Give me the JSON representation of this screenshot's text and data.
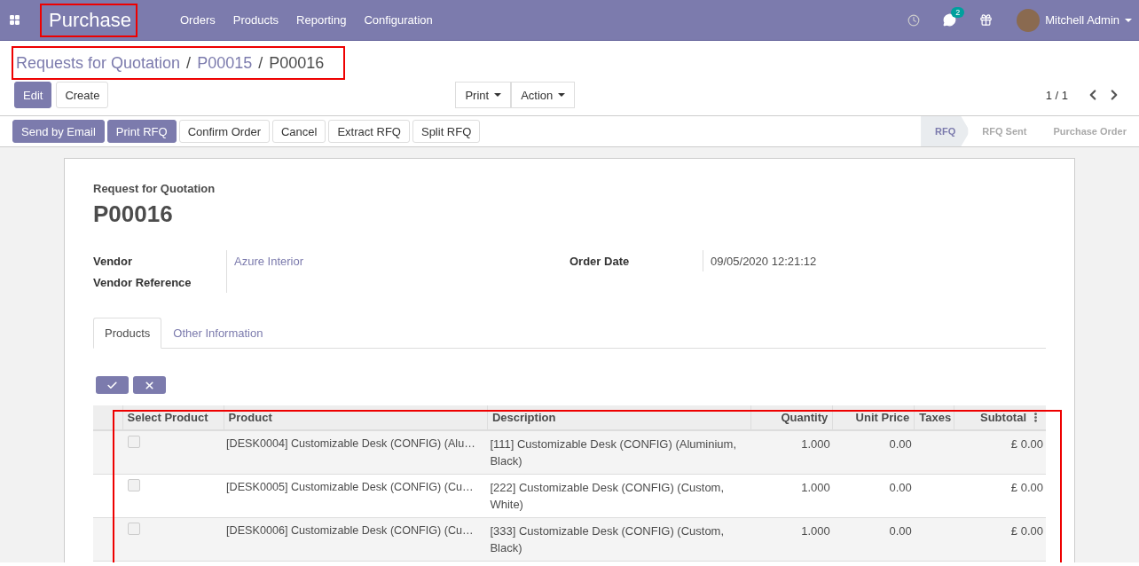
{
  "navbar": {
    "app_title": {
      "text": "Purchase",
      "highlighted": true
    },
    "menu": [
      "Orders",
      "Products",
      "Reporting",
      "Configuration"
    ],
    "messages_badge": "2",
    "user": "Mitchell Admin"
  },
  "breadcrumb": {
    "highlighted": true,
    "separator": "/",
    "items": [
      {
        "label": "Requests for Quotation",
        "current": false
      },
      {
        "label": "P00015",
        "current": false
      },
      {
        "label": "P00016",
        "current": true
      }
    ]
  },
  "control_buttons": [
    {
      "label": "Edit",
      "primary": true
    },
    {
      "label": "Create",
      "primary": false
    }
  ],
  "dropdowns": [
    "Print",
    "Action"
  ],
  "pager": "1 / 1",
  "header_buttons": [
    {
      "label": "Send by Email",
      "primary": true
    },
    {
      "label": "Print RFQ",
      "primary": true
    },
    {
      "label": "Confirm Order",
      "primary": false
    },
    {
      "label": "Cancel",
      "primary": false
    },
    {
      "label": "Extract RFQ",
      "primary": false
    },
    {
      "label": "Split RFQ",
      "primary": false
    }
  ],
  "status_steps": [
    {
      "label": "RFQ",
      "selected": true
    },
    {
      "label": "RFQ Sent",
      "selected": false
    },
    {
      "label": "Purchase Order",
      "selected": false
    }
  ],
  "sheet": {
    "subtitle": "Request for Quotation",
    "name": "P00016",
    "left_fields": [
      {
        "label": "Vendor",
        "value": "Azure Interior"
      },
      {
        "label": "Vendor Reference"
      }
    ],
    "right_fields": [
      {
        "label": "Order Date",
        "value": "09/05/2020 12:21:12"
      }
    ],
    "tabs": [
      {
        "label": "Products",
        "selected": true
      },
      {
        "label": "Other Information",
        "selected": false
      }
    ],
    "table": {
      "highlighted": true,
      "columns": [
        "Select Product",
        "Product",
        "Description",
        "Quantity",
        "Unit Price",
        "Taxes",
        "Subtotal"
      ],
      "rows": [
        {
          "checked": false,
          "product": "[DESK0004] Customizable Desk (CONFIG) (Alu…",
          "description": "[111] Customizable Desk (CONFIG) (Aluminium, Black)",
          "quantity": "1.000",
          "unit_price": "0.00",
          "subtotal": "£ 0.00"
        },
        {
          "checked": false,
          "product": "[DESK0005] Customizable Desk (CONFIG) (Cu…",
          "description": "[222] Customizable Desk (CONFIG) (Custom, White)",
          "quantity": "1.000",
          "unit_price": "0.00",
          "subtotal": "£ 0.00"
        },
        {
          "checked": false,
          "product": "[DESK0006] Customizable Desk (CONFIG) (Cu…",
          "description": "[333] Customizable Desk (CONFIG) (Custom, Black)",
          "quantity": "1.000",
          "unit_price": "0.00",
          "subtotal": "£ 0.00"
        }
      ]
    }
  }
}
